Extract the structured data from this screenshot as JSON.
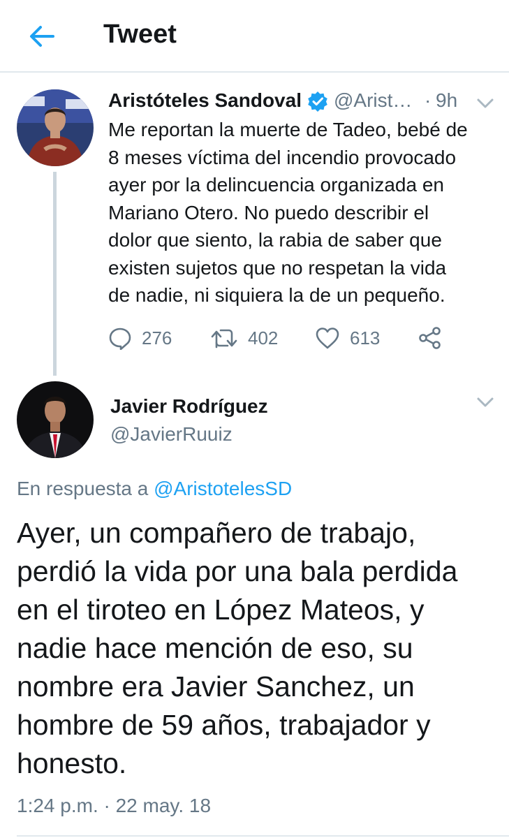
{
  "header": {
    "title": "Tweet",
    "back_icon": "arrow-left-icon",
    "accent": "#1da1f2"
  },
  "parent_tweet": {
    "author_name": "Aristóteles Sandoval",
    "handle": "@Arist…",
    "separator": "·",
    "time": "9h",
    "verified": true,
    "text": "Me reportan la muerte de Tadeo, bebé de\n8 meses víctima del incendio provocado\nayer por la delincuencia organizada en\nMariano Otero. No puedo describir el\ndolor que siento, la rabia de saber que\nexisten sujetos que no respetan la vida\nde nadie, ni siquiera la de un pequeño.",
    "replies": "276",
    "retweets": "402",
    "likes": "613"
  },
  "reply_tweet": {
    "author_name": "Javier Rodríguez",
    "handle": "@JavierRuuiz",
    "reply_prefix": "En respuesta a",
    "reply_to": "@AristotelesSD",
    "text": "Ayer, un compañero de trabajo,\nperdió la vida por una bala perdida\nen el tiroteo en López Mateos, y\nnadie hace mención de eso, su\nnombre era Javier Sanchez, un\nhombre de 59 años, trabajador y\nhonesto.",
    "timestamp": "1:24 p.m. · 22 may. 18"
  },
  "colors": {
    "text": "#14171a",
    "muted": "#657786",
    "link": "#1da1f2",
    "divider": "#e1e8ed"
  }
}
